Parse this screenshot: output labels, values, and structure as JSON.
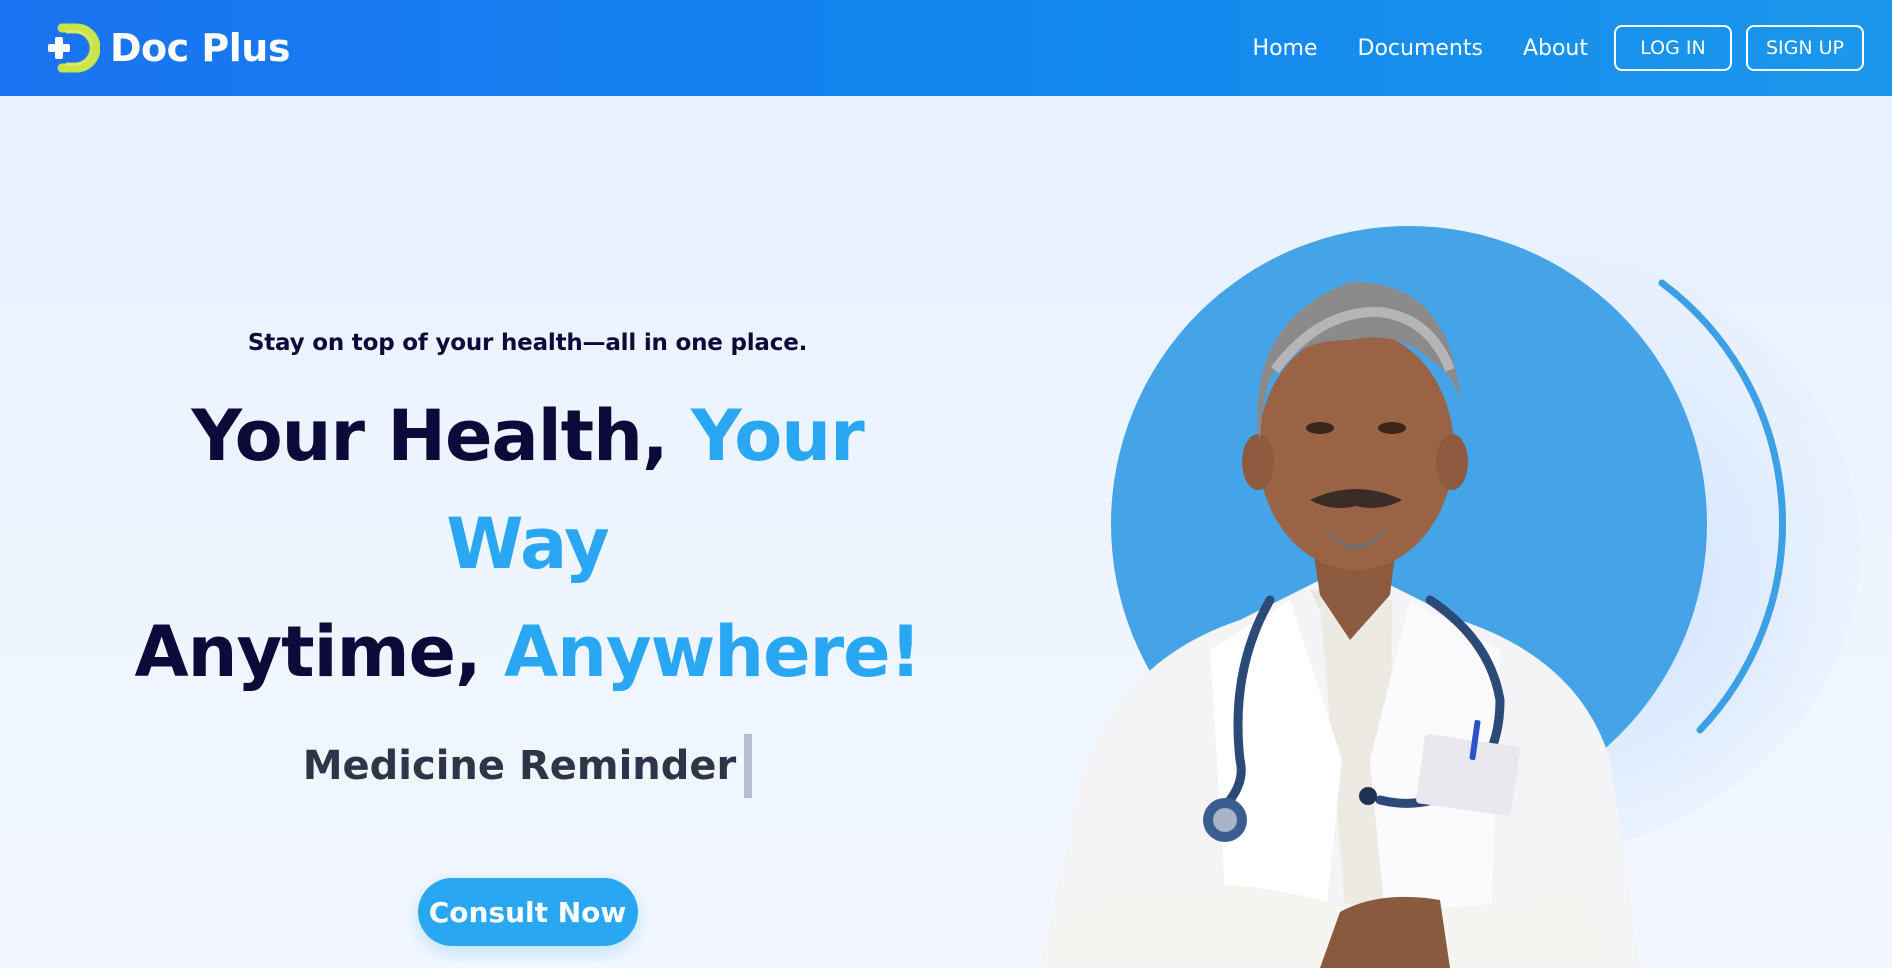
{
  "brand": {
    "name": "Doc Plus",
    "logo_icon": "plus-d-logo-icon"
  },
  "nav": {
    "links": [
      "Home",
      "Documents",
      "About"
    ],
    "login_label": "LOG IN",
    "signup_label": "SIGN UP"
  },
  "hero": {
    "tagline": "Stay on top of your health—all in one place.",
    "headline_line1_dark": "Your Health,",
    "headline_line1_accent": "Your Way",
    "headline_line2_dark": "Anytime,",
    "headline_line2_accent": "Anywhere!",
    "rotating_text": "Medicine Reminder",
    "cta_label": "Consult Now"
  },
  "image": {
    "subject": "doctor-portrait"
  },
  "colors": {
    "navbar_start": "#1a73f0",
    "navbar_end": "#1a97ec",
    "dark_text": "#0d0a3a",
    "accent": "#2aa7f2",
    "circle": "#45a4e8",
    "background": "#e9f2ff"
  }
}
